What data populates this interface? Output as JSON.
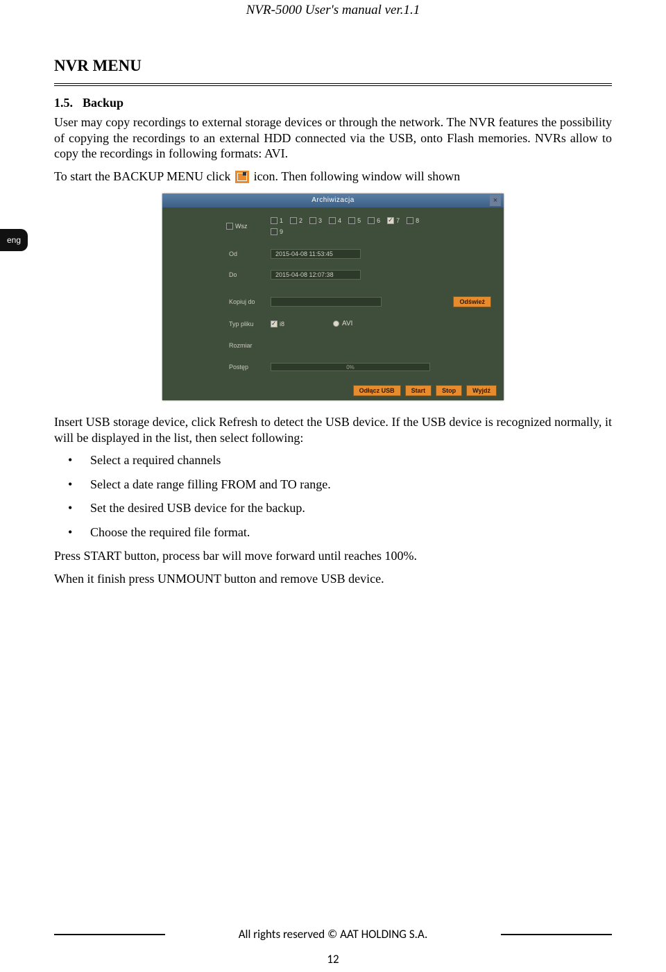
{
  "doc": {
    "header": "NVR-5000 User's manual ver.1.1",
    "section_title": "NVR MENU",
    "subsection_num": "1.5.",
    "subsection_title": "Backup",
    "para1": "User may copy recordings to external storage devices or through the network. The NVR features the possibility of copying the recordings to an external HDD connected via the USB, onto Flash memories. NVRs allow to copy the recordings in following formats: AVI.",
    "para2a": "To start the BACKUP MENU click ",
    "para2b": " icon. Then following window will shown",
    "para3": "Insert USB storage device, click Refresh to detect the USB device. If the USB device is recognized normally, it will be displayed in the list, then select following:",
    "bullets": [
      "Select a required channels",
      "Select a date range filling FROM and TO range.",
      "Set the desired USB device for the backup.",
      "Choose the required file format."
    ],
    "para4": "Press START button, process bar will move forward until reaches 100%.",
    "para5": "When it finish press UNMOUNT button and remove USB device.",
    "footer": "All rights reserved © AAT HOLDING S.A.",
    "page_number": "12",
    "lang_tab": "eng"
  },
  "shot": {
    "title": "Archiwizacja",
    "labels": {
      "all": "Wsz",
      "from": "Od",
      "to": "Do",
      "copyto": "Kopiuj do",
      "filetype": "Typ pliku",
      "size": "Rozmiar",
      "progress": "Postęp"
    },
    "channels": [
      "1",
      "2",
      "3",
      "4",
      "5",
      "6",
      "7",
      "8",
      "9"
    ],
    "channel_checked_index": 6,
    "from_value": "2015-04-08 11:53:45",
    "to_value": "2015-04-08 12:07:38",
    "refresh": "Odśwież",
    "filetype_opts": {
      "i8": "i8",
      "avi": "AVI"
    },
    "progress_text": "0%",
    "footer_buttons": [
      "Odłącz USB",
      "Start",
      "Stop",
      "Wyjdź"
    ]
  }
}
